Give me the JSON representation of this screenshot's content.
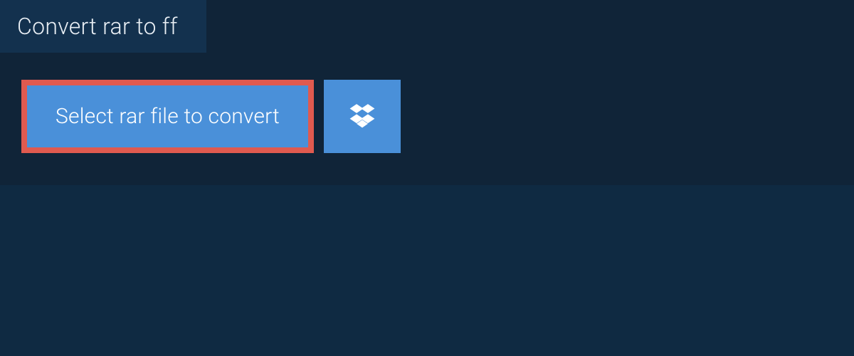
{
  "tab": {
    "title": "Convert rar to ff"
  },
  "actions": {
    "select_file_label": "Select rar file to convert"
  },
  "colors": {
    "accent": "#4a90d9",
    "highlight_border": "#e05a4f",
    "bg_dark": "#0f2a42",
    "panel": "#102438",
    "tab": "#13314e"
  }
}
